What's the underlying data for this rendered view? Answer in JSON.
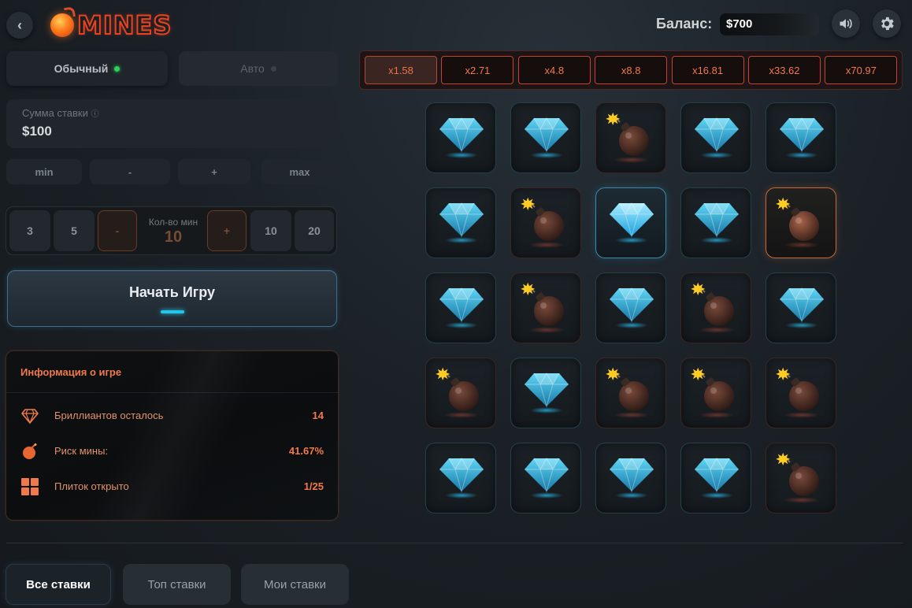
{
  "header": {
    "logo_text": "MINES",
    "balance_label": "Баланс:",
    "balance_value": "$700",
    "icons": [
      "chevron-left-icon",
      "fireball-icon",
      "speaker-icon",
      "gear-icon"
    ]
  },
  "mode_tabs": {
    "normal": "Обычный",
    "auto": "Авто"
  },
  "bet": {
    "label": "Сумма ставки",
    "value": "$100",
    "buttons": [
      "min",
      "-",
      "+",
      "max"
    ]
  },
  "mines": {
    "presets": [
      "3",
      "5",
      "10",
      "20"
    ],
    "minus": "-",
    "plus": "+",
    "label": "Кол-во мин",
    "value": "10"
  },
  "start_button": "Начать Игру",
  "info": {
    "title": "Информация о игре",
    "rows": [
      {
        "label": "Бриллиантов осталось",
        "value": "14"
      },
      {
        "label": "Риск мины:",
        "value": "41.67%"
      },
      {
        "label": "Плиток открыто",
        "value": "1/25"
      }
    ]
  },
  "multipliers": [
    "x1.58",
    "x2.71",
    "x4.8",
    "x8.8",
    "x16.81",
    "x33.62",
    "x70.97"
  ],
  "grid": [
    [
      "gem",
      "gem",
      "bomb",
      "gem",
      "gem"
    ],
    [
      "gem",
      "bomb",
      "gem-open",
      "gem",
      "bomb-open"
    ],
    [
      "gem",
      "bomb",
      "gem",
      "bomb",
      "gem"
    ],
    [
      "bomb",
      "gem",
      "bomb",
      "bomb",
      "bomb"
    ],
    [
      "gem",
      "gem",
      "gem",
      "gem",
      "bomb"
    ]
  ],
  "bottom_tabs": [
    "Все ставки",
    "Топ ставки",
    "Мои ставки"
  ],
  "colors": {
    "accent_orange": "#f07a4a",
    "accent_cyan": "#27c4ea",
    "active_dot": "#2fce5a"
  }
}
